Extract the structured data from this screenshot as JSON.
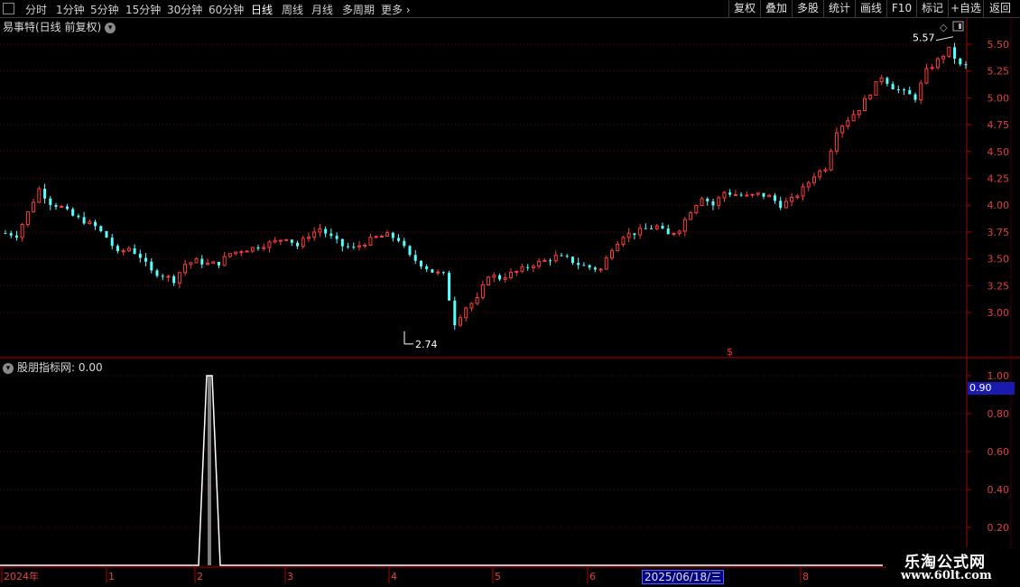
{
  "toolbar": {
    "periods": [
      {
        "label": "分时",
        "active": false
      },
      {
        "label": "1分钟",
        "active": false
      },
      {
        "label": "5分钟",
        "active": false
      },
      {
        "label": "15分钟",
        "active": false
      },
      {
        "label": "30分钟",
        "active": false
      },
      {
        "label": "60分钟",
        "active": false
      },
      {
        "label": "日线",
        "active": true
      },
      {
        "label": "周线",
        "active": false
      },
      {
        "label": "月线",
        "active": false
      },
      {
        "label": "多周期",
        "active": false
      },
      {
        "label": "更多",
        "active": false
      }
    ],
    "right_buttons": [
      "复权",
      "叠加",
      "多股",
      "统计",
      "画线",
      "F10",
      "标记",
      "+自选",
      "返回"
    ]
  },
  "chart": {
    "title": "易事特(日线 前复权)",
    "price_axis": [
      "5.50",
      "5.25",
      "5.00",
      "4.75",
      "4.50",
      "4.25",
      "4.00",
      "3.75",
      "3.50",
      "3.25",
      "3.00"
    ],
    "high_label": "5.57",
    "low_label": "2.74",
    "event_marker": "$"
  },
  "indicator": {
    "title": "股朋指标网",
    "value_text": ": 0.00",
    "axis": [
      "1.00",
      "0.80",
      "0.60",
      "0.40",
      "0.20"
    ],
    "current_value": "0.90"
  },
  "timeline": {
    "labels": [
      "2024年",
      "1",
      "2",
      "3",
      "4",
      "5",
      "6",
      "8"
    ],
    "selected_date": "2025/06/18/三"
  },
  "watermark": {
    "title": "乐淘公式网",
    "url": "www.60lt.com"
  },
  "colors": {
    "up": "#ff3b3b",
    "down": "#54ffff",
    "axis": "#b00000",
    "grid": "#6a0000",
    "indicator_line": "#ffffff"
  },
  "chart_data": {
    "type": "candlestick",
    "title": "易事特(日线 前复权)",
    "y_range": [
      2.6,
      5.7
    ],
    "high": 5.57,
    "low": 2.74,
    "close_path": [
      3.74,
      3.72,
      3.93,
      4.15,
      4.02,
      3.98,
      3.9,
      3.85,
      3.8,
      3.7,
      3.55,
      3.6,
      3.52,
      3.38,
      3.35,
      3.3,
      3.45,
      3.48,
      3.45,
      3.46,
      3.55,
      3.58,
      3.6,
      3.63,
      3.66,
      3.7,
      3.62,
      3.72,
      3.78,
      3.7,
      3.62,
      3.6,
      3.65,
      3.7,
      3.72,
      3.68,
      3.52,
      3.45,
      3.38,
      3.35,
      2.9,
      3.05,
      3.12,
      3.35,
      3.32,
      3.36,
      3.4,
      3.45,
      3.48,
      3.52,
      3.5,
      3.45,
      3.42,
      3.4,
      3.6,
      3.72,
      3.74,
      3.78,
      3.8,
      3.72,
      3.78,
      3.95,
      4.08,
      4.0,
      4.12,
      4.1,
      4.08,
      4.1,
      4.08,
      4.0,
      4.05,
      4.15,
      4.28,
      4.35,
      4.7,
      4.8,
      4.9,
      5.05,
      5.2,
      5.1,
      5.05,
      5.0,
      5.25,
      5.35,
      5.45,
      5.3
    ],
    "indicator_series": {
      "name": "股朋指标网",
      "values": [
        0,
        0,
        0,
        0,
        0,
        0,
        0,
        0,
        0,
        0,
        0,
        0,
        0,
        0,
        0,
        0,
        0,
        0,
        0,
        1,
        0,
        0,
        0,
        0,
        0,
        0,
        0,
        0,
        0,
        0,
        0,
        0,
        0,
        0,
        0,
        0,
        0,
        0,
        0,
        0,
        0,
        0,
        0,
        0,
        0,
        0,
        0,
        0,
        0,
        0,
        0,
        0,
        0,
        0,
        0,
        0,
        0,
        0,
        0,
        0,
        0,
        0,
        0,
        0,
        0,
        0,
        0,
        0,
        0,
        0,
        0,
        0,
        0,
        0,
        0,
        0,
        0,
        0,
        0,
        0,
        0,
        0,
        0,
        0,
        0,
        0
      ],
      "ylim": [
        0,
        1.0
      ]
    }
  }
}
